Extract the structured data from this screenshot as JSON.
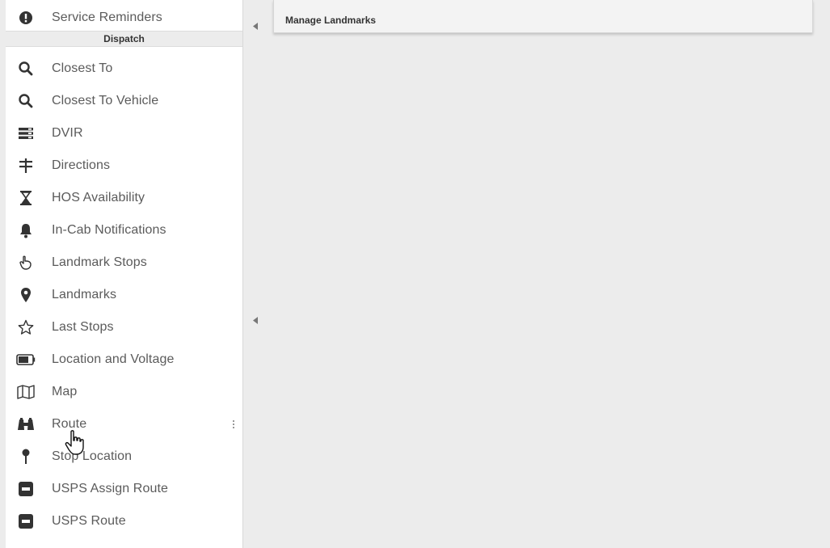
{
  "sidebar": {
    "top_item": {
      "label": "Service Reminders",
      "icon": "alert-circle-icon"
    },
    "section_header": "Dispatch",
    "items": [
      {
        "label": "Closest To",
        "icon": "search-icon"
      },
      {
        "label": "Closest To Vehicle",
        "icon": "search-icon"
      },
      {
        "label": "DVIR",
        "icon": "list-icon"
      },
      {
        "label": "Directions",
        "icon": "signpost-icon"
      },
      {
        "label": "HOS Availability",
        "icon": "hourglass-icon"
      },
      {
        "label": "In-Cab Notifications",
        "icon": "bell-icon"
      },
      {
        "label": "Landmark Stops",
        "icon": "hand-icon"
      },
      {
        "label": "Landmarks",
        "icon": "map-pin-icon"
      },
      {
        "label": "Last Stops",
        "icon": "star-outline-icon"
      },
      {
        "label": "Location and Voltage",
        "icon": "battery-icon"
      },
      {
        "label": "Map",
        "icon": "map-icon"
      },
      {
        "label": "Route",
        "icon": "binoculars-icon"
      },
      {
        "label": "Stop Location",
        "icon": "pushpin-icon"
      },
      {
        "label": "USPS Assign Route",
        "icon": "square-box-icon"
      },
      {
        "label": "USPS Route",
        "icon": "square-box-icon"
      }
    ]
  },
  "panel": {
    "title": "Manage Landmarks"
  },
  "colors": {
    "icon": "#333333",
    "label": "#5b5b5b",
    "background": "#ececec"
  }
}
